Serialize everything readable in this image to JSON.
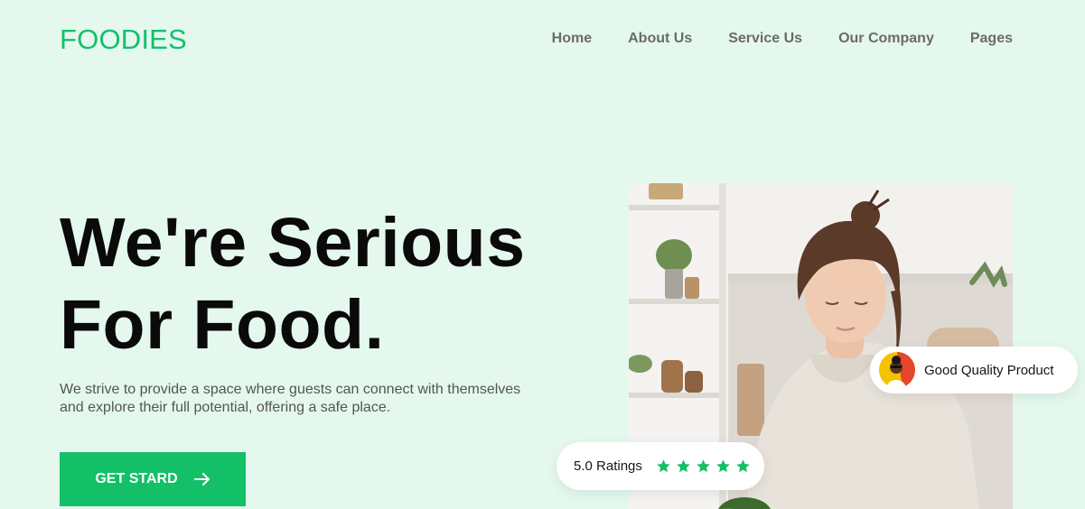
{
  "brand": {
    "logo": "FOODIES",
    "accent_color": "#13bf67"
  },
  "nav": {
    "items": [
      {
        "label": "Home"
      },
      {
        "label": "About Us"
      },
      {
        "label": "Service Us"
      },
      {
        "label": "Our Company"
      },
      {
        "label": "Pages"
      }
    ]
  },
  "hero": {
    "headline_line1": "We're Serious",
    "headline_line2": "For Food.",
    "subtitle_line1": "We strive to provide a space where guests can connect with themselves",
    "subtitle_line2": "and explore their full potential, offering a safe place.",
    "cta_label": "GET STARD",
    "cta_icon": "arrow-right-icon"
  },
  "badges": {
    "quality_label": "Good Quality Product",
    "quality_icon": "avatar",
    "ratings_label": "5.0 Ratings",
    "rating_stars": 5,
    "star_color": "#13bf67"
  }
}
